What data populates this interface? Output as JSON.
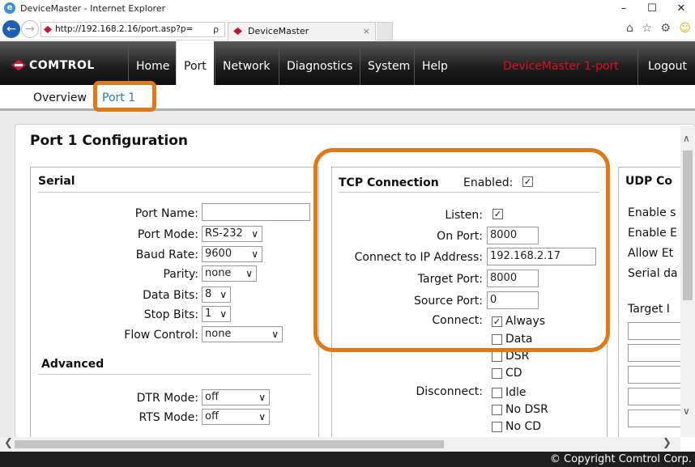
{
  "window": {
    "title": "DeviceMaster - Internet Explorer",
    "minimize": "–",
    "maximize": "☐",
    "close": "✕"
  },
  "browser": {
    "url": "http://192.168.2.16/port.asp?p=",
    "url_tools": "ρ ▾ C",
    "tab_title": "DeviceMaster",
    "tab_close": "×",
    "tool_icons": "⌂ ☆ ⚙",
    "smiley": "☺",
    "back": "←",
    "forward": "→"
  },
  "nav": {
    "logo": "COMTROL",
    "items": [
      "Home",
      "Port",
      "Network",
      "Diagnostics",
      "System",
      "Help"
    ],
    "active": "Port",
    "device_name": "DeviceMaster 1-port",
    "logout": "Logout"
  },
  "subnav": {
    "overview": "Overview",
    "port1": "Port 1"
  },
  "page": {
    "heading": "Port 1 Configuration"
  },
  "serial": {
    "title": "Serial",
    "port_name_label": "Port Name:",
    "port_name_value": "",
    "port_mode_label": "Port Mode:",
    "port_mode_value": "RS-232",
    "baud_rate_label": "Baud Rate:",
    "baud_rate_value": "9600",
    "parity_label": "Parity:",
    "parity_value": "none",
    "data_bits_label": "Data Bits:",
    "data_bits_value": "8",
    "stop_bits_label": "Stop Bits:",
    "stop_bits_value": "1",
    "flow_control_label": "Flow Control:",
    "flow_control_value": "none"
  },
  "advanced": {
    "title": "Advanced",
    "dtr_mode_label": "DTR Mode:",
    "dtr_mode_value": "off",
    "rts_mode_label": "RTS Mode:",
    "rts_mode_value": "off"
  },
  "tcp": {
    "title": "TCP Connection",
    "enabled_label": "Enabled:",
    "enabled": true,
    "listen_label": "Listen:",
    "listen": true,
    "on_port_label": "On Port:",
    "on_port_value": "8000",
    "connect_ip_label": "Connect to IP Address:",
    "connect_ip_value": "192.168.2.17",
    "target_port_label": "Target Port:",
    "target_port_value": "8000",
    "source_port_label": "Source Port:",
    "source_port_value": "0",
    "connect_label": "Connect:",
    "connect_options": [
      {
        "label": "Always",
        "checked": true
      },
      {
        "label": "Data",
        "checked": false
      },
      {
        "label": "DSR",
        "checked": false
      },
      {
        "label": "CD",
        "checked": false
      }
    ],
    "disconnect_label": "Disconnect:",
    "disconnect_options": [
      {
        "label": "Idle",
        "checked": false
      },
      {
        "label": "No DSR",
        "checked": false
      },
      {
        "label": "No CD",
        "checked": false
      }
    ]
  },
  "udp": {
    "title": "UDP Co",
    "lines": [
      "Enable s",
      "Enable E",
      "Allow Et",
      "Serial da"
    ],
    "target_label": "Target I"
  },
  "footer": {
    "copyright": "© Copyright Comtrol Corp."
  },
  "colors": {
    "highlight": "#e07813",
    "device_name": "#d8101e",
    "brand_red": "#e31837",
    "active_subnav": "#2a7ab0"
  }
}
